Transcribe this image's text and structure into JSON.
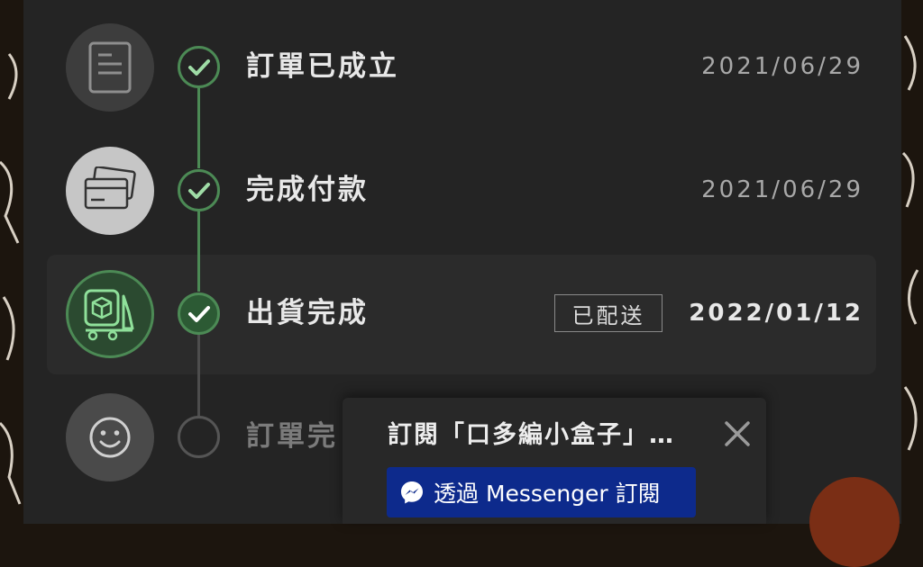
{
  "timeline": {
    "steps": [
      {
        "label": "訂單已成立",
        "date": "2021/06/29",
        "icon": "document-icon"
      },
      {
        "label": "完成付款",
        "date": "2021/06/29",
        "icon": "credit-card-icon"
      },
      {
        "label": "出貨完成",
        "date": "2022/01/12",
        "badge": "已配送",
        "icon": "delivery-box-icon"
      },
      {
        "label": "訂單完",
        "icon": "smiley-icon"
      }
    ]
  },
  "popup": {
    "title": "訂閱「口多編小盒子」…",
    "button_label": "透過 Messenger 訂閱",
    "close_icon": "close-icon",
    "messenger_icon": "messenger-icon"
  },
  "colors": {
    "accent_green": "#4c8a55",
    "messenger_blue": "#0d2a8c",
    "panel_bg": "#242424"
  }
}
